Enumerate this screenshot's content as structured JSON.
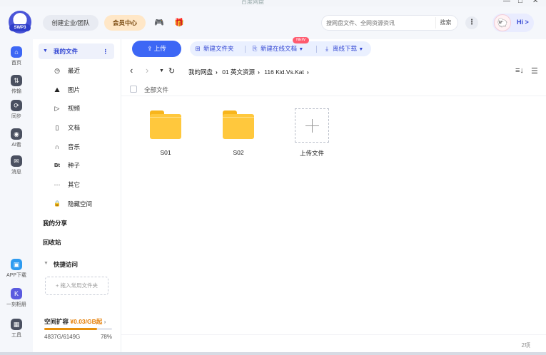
{
  "window": {
    "title": "百度网盘",
    "controls": [
      "—",
      "□",
      "✕"
    ]
  },
  "header": {
    "logo_label": "SWP3",
    "team_label": "创建企业/团队",
    "vip_label": "会员中心",
    "search_placeholder": "搜网盘文件、全网资源资讯",
    "search_button": "搜索",
    "more_label": "⋮",
    "greeting": "Hi >"
  },
  "rail": [
    {
      "label": "首页",
      "icon": "home-icon",
      "color": "#3d67f5"
    },
    {
      "label": "传输",
      "icon": "transfer-icon",
      "color": "#4a5060"
    },
    {
      "label": "同步",
      "icon": "sync-icon",
      "color": "#4a5060"
    },
    {
      "label": "AI看",
      "icon": "ai-watch-icon",
      "color": "#4a5060"
    },
    {
      "label": "消息",
      "icon": "message-icon",
      "color": "#4a5060"
    },
    {
      "label": "APP下载",
      "icon": "app-download-icon",
      "color": "#2e9bf0"
    },
    {
      "label": "一刻相册",
      "icon": "album-icon",
      "color": "#5a5adf"
    },
    {
      "label": "工具",
      "icon": "tools-icon",
      "color": "#4a5060"
    }
  ],
  "sidebar": {
    "my_files": "我的文件",
    "categories": [
      {
        "label": "最近",
        "icon": "◷"
      },
      {
        "label": "图片",
        "icon": "⛰"
      },
      {
        "label": "视频",
        "icon": "▷"
      },
      {
        "label": "文档",
        "icon": "▯"
      },
      {
        "label": "音乐",
        "icon": "∩"
      },
      {
        "label": "种子",
        "icon": "Bt"
      },
      {
        "label": "其它",
        "icon": "···"
      },
      {
        "label": "隐藏空间",
        "icon": "🔒"
      }
    ],
    "my_share": "我的分享",
    "recycle": "回收站",
    "quick_access": "快捷访问",
    "add_favorite": "+ 拖入常用文件夹",
    "space_label": "空间扩容",
    "space_promo": "¥0.03/GB起",
    "quota_used": "4837G/6149G",
    "quota_pct": "78%",
    "quota_fraction": 0.78
  },
  "toolbar": {
    "upload": "上传",
    "new_folder": "新建文件夹",
    "new_doc": "新建在线文档",
    "new_badge": "NEW",
    "offline_download": "离线下载"
  },
  "breadcrumb": [
    "我的网盘",
    "01 英文资源",
    "116 Kid.Vs.Kat"
  ],
  "list": {
    "select_all": "全部文件",
    "items": [
      {
        "name": "S01",
        "type": "folder"
      },
      {
        "name": "S02",
        "type": "folder"
      }
    ],
    "upload_tile": "上传文件",
    "count": "2项"
  }
}
